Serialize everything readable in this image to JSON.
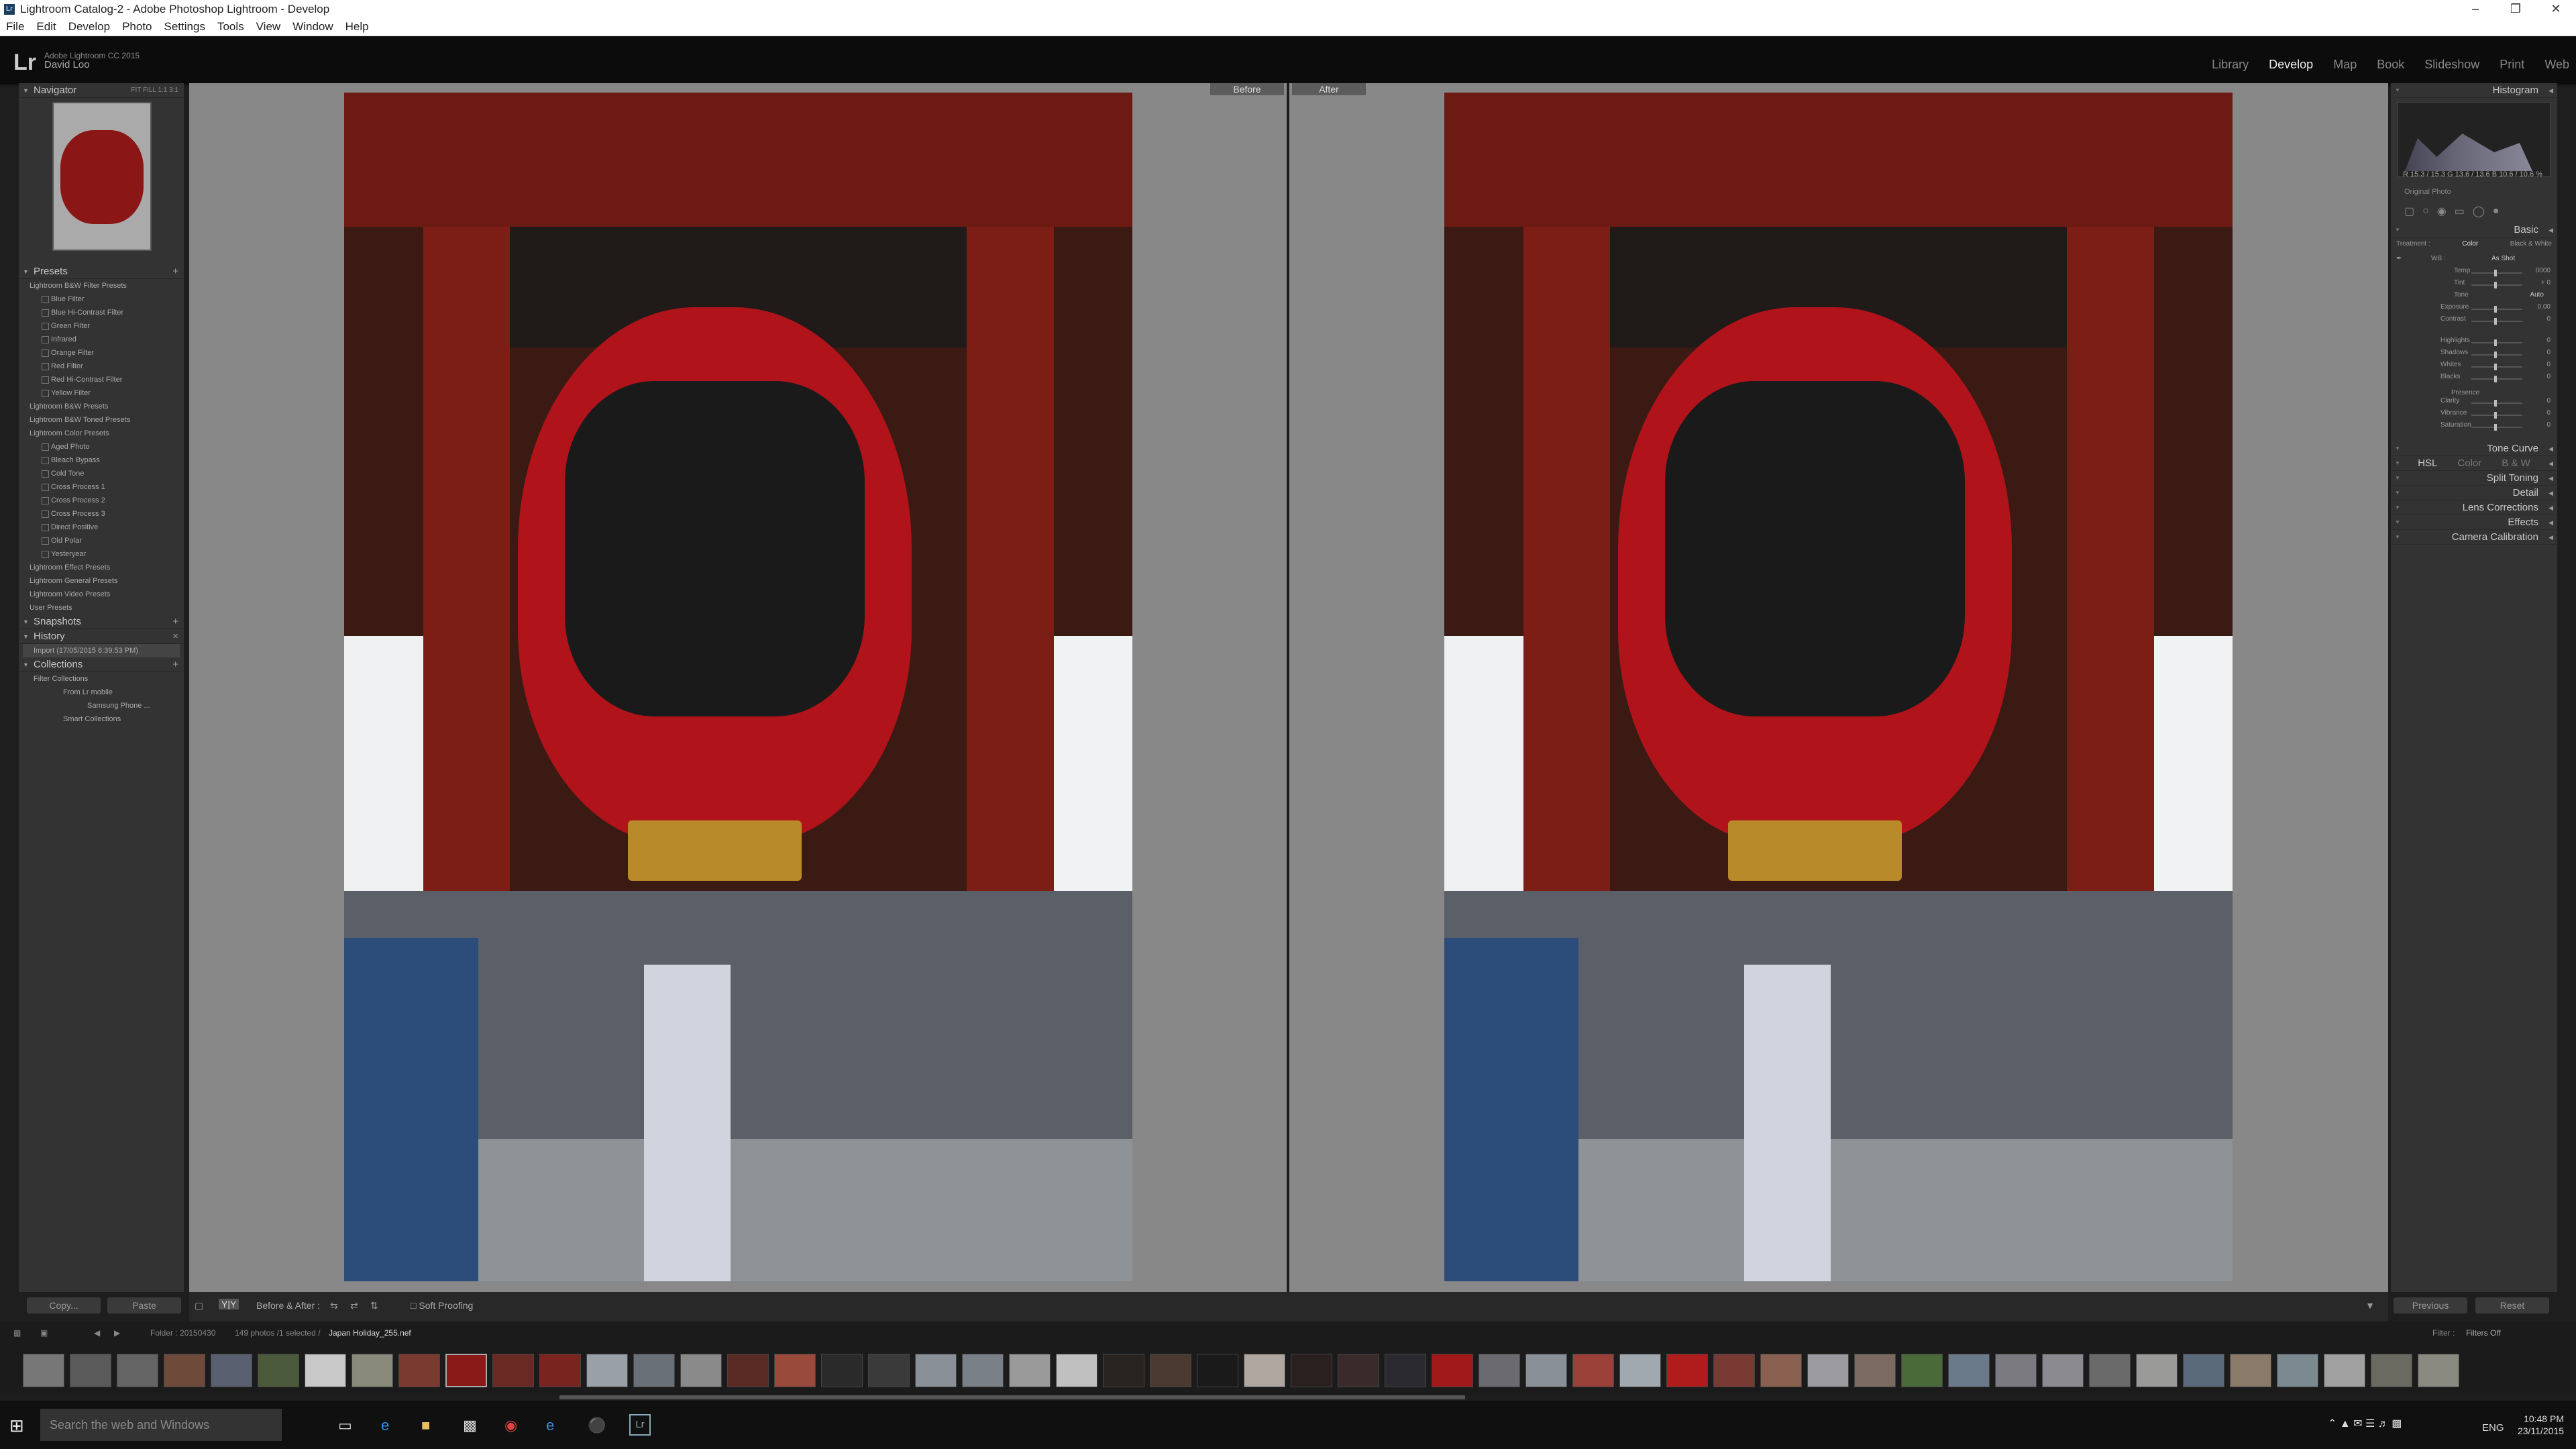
{
  "window": {
    "title": "Lightroom Catalog-2 - Adobe Photoshop Lightroom - Develop"
  },
  "menu": [
    "File",
    "Edit",
    "Develop",
    "Photo",
    "Settings",
    "Tools",
    "View",
    "Window",
    "Help"
  ],
  "identity": {
    "product": "Adobe Lightroom CC 2015",
    "user": "David Loo",
    "logo": "Lr"
  },
  "modules": [
    {
      "label": "Library"
    },
    {
      "label": "Develop"
    },
    {
      "label": "Map"
    },
    {
      "label": "Book"
    },
    {
      "label": "Slideshow"
    },
    {
      "label": "Print"
    },
    {
      "label": "Web"
    }
  ],
  "left": {
    "navigator": {
      "title": "Navigator",
      "zoom": [
        "FIT",
        "FILL",
        "1:1",
        "3:1"
      ]
    },
    "presets": {
      "title": "Presets",
      "rows": [
        {
          "label": "Lightroom B&W Filter Presets",
          "kind": "folder"
        },
        {
          "label": "Blue Filter",
          "kind": "item"
        },
        {
          "label": "Blue Hi-Contrast Filter",
          "kind": "item"
        },
        {
          "label": "Green Filter",
          "kind": "item"
        },
        {
          "label": "Infrared",
          "kind": "item"
        },
        {
          "label": "Orange Filter",
          "kind": "item"
        },
        {
          "label": "Red Filter",
          "kind": "item"
        },
        {
          "label": "Red Hi-Contrast Filter",
          "kind": "item"
        },
        {
          "label": "Yellow Filter",
          "kind": "item"
        },
        {
          "label": "Lightroom B&W Presets",
          "kind": "folder"
        },
        {
          "label": "Lightroom B&W Toned Presets",
          "kind": "folder"
        },
        {
          "label": "Lightroom Color Presets",
          "kind": "folder"
        },
        {
          "label": "Aged Photo",
          "kind": "item"
        },
        {
          "label": "Bleach Bypass",
          "kind": "item"
        },
        {
          "label": "Cold Tone",
          "kind": "item"
        },
        {
          "label": "Cross Process 1",
          "kind": "item"
        },
        {
          "label": "Cross Process 2",
          "kind": "item"
        },
        {
          "label": "Cross Process 3",
          "kind": "item"
        },
        {
          "label": "Direct Positive",
          "kind": "item"
        },
        {
          "label": "Old Polar",
          "kind": "item"
        },
        {
          "label": "Yesteryear",
          "kind": "item"
        },
        {
          "label": "Lightroom Effect Presets",
          "kind": "folder"
        },
        {
          "label": "Lightroom General Presets",
          "kind": "folder"
        },
        {
          "label": "Lightroom Video Presets",
          "kind": "folder"
        },
        {
          "label": "User Presets",
          "kind": "folder"
        }
      ]
    },
    "snapshots": {
      "title": "Snapshots"
    },
    "history": {
      "title": "History",
      "entry": "Import (17/05/2015 6:39:53 PM)"
    },
    "collections": {
      "title": "Collections",
      "rows": [
        "Filter Collections",
        "From Lr mobile",
        "Samsung Phone ...",
        "Smart Collections"
      ]
    },
    "copy_label": "Copy...",
    "paste_label": "Paste"
  },
  "center": {
    "before_label": "Before",
    "after_label": "After"
  },
  "right": {
    "histogram_title": "Histogram",
    "histogram_info": "R 15.3 / 15.3  G 13.6 / 13.6  B 10.6 / 10.6  %",
    "original_photo": "Original Photo",
    "basic_title": "Basic",
    "treatment": {
      "label": "Treatment :",
      "color": "Color",
      "bw": "Black & White"
    },
    "wb": {
      "label": "WB :",
      "value": "As Shot"
    },
    "temp": {
      "label": "Temp",
      "value": "0000"
    },
    "tint": {
      "label": "Tint",
      "value": "+ 0"
    },
    "tone_label": "Tone",
    "auto_label": "Auto",
    "sliders": [
      {
        "label": "Exposure",
        "value": "0.00"
      },
      {
        "label": "Contrast",
        "value": "0"
      },
      {
        "label": "Highlights",
        "value": "0"
      },
      {
        "label": "Shadows",
        "value": "0"
      },
      {
        "label": "Whites",
        "value": "0"
      },
      {
        "label": "Blacks",
        "value": "0"
      }
    ],
    "presence_label": "Presence",
    "presence": [
      {
        "label": "Clarity",
        "value": "0"
      },
      {
        "label": "Vibrance",
        "value": "0"
      },
      {
        "label": "Saturation",
        "value": "0"
      }
    ],
    "sections": [
      "Tone Curve",
      "Split Toning",
      "Detail",
      "Lens Corrections",
      "Effects",
      "Camera Calibration"
    ],
    "hsl": {
      "hsl": "HSL",
      "color": "Color",
      "bw": "B & W"
    },
    "previous_label": "Previous",
    "reset_label": "Reset"
  },
  "toolbar": {
    "before_after": "Before & After :",
    "soft_proofing": "Soft Proofing"
  },
  "film": {
    "folder": "Folder : 20150430",
    "count": "149 photos /1 selected /",
    "filename": "Japan Holiday_255.nef",
    "filter_label": "Filter :",
    "filter_value": "Filters Off"
  },
  "taskbar": {
    "search": "Search the web and Windows",
    "lang": "ENG",
    "time": "10:48 PM",
    "date": "23/11/2015"
  }
}
